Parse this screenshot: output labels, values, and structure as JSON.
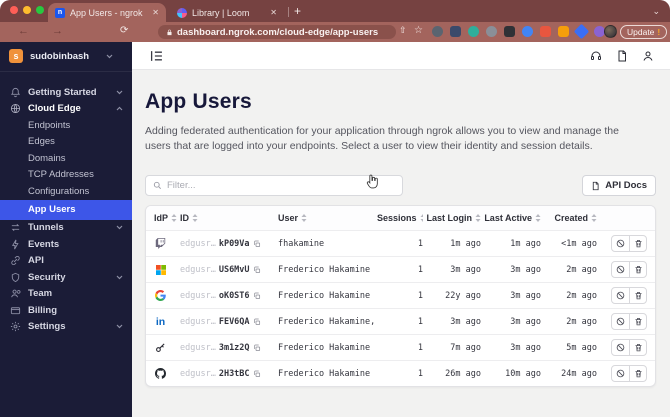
{
  "colors": {
    "chrome_dark": "#764241",
    "chrome_light": "#a3645d",
    "sidebar_bg": "#1b1c37",
    "accent_blue": "#3d56e8",
    "logo_orange": "#f0923b",
    "ms_red": "#f25022",
    "ms_green": "#7fba00",
    "ms_blue": "#00a4ef",
    "ms_yellow": "#ffb900",
    "linkedin_blue": "#0a66c2"
  },
  "icons": {
    "close": "✕",
    "plus": "+",
    "chevron_down": "⌄",
    "back": "←",
    "forward": "→",
    "refresh": "⟳",
    "star": "☆",
    "share": "⇧",
    "excl": "!"
  },
  "browser": {
    "tabs": [
      {
        "title": "App Users - ngrok"
      },
      {
        "title": "Library | Loom"
      }
    ],
    "url": "dashboard.ngrok.com/cloud-edge/app-users",
    "update_label": "Update"
  },
  "sidebar": {
    "account": {
      "name": "sudobinbash",
      "avatar_letter": "s"
    },
    "items": [
      {
        "label": "Getting Started"
      },
      {
        "label": "Cloud Edge"
      },
      {
        "label": "Endpoints"
      },
      {
        "label": "Edges"
      },
      {
        "label": "Domains"
      },
      {
        "label": "TCP Addresses"
      },
      {
        "label": "Configurations"
      },
      {
        "label": "App Users"
      },
      {
        "label": "Tunnels"
      },
      {
        "label": "Events"
      },
      {
        "label": "API"
      },
      {
        "label": "Security"
      },
      {
        "label": "Team"
      },
      {
        "label": "Billing"
      },
      {
        "label": "Settings"
      }
    ]
  },
  "main": {
    "title": "App Users",
    "description": "Adding federated authentication for your application through ngrok allows you to view and manage the users that are logged into your endpoints. Select a user to view their identity and session details.",
    "filter_placeholder": "Filter...",
    "api_docs_label": "API Docs"
  },
  "table": {
    "headers": [
      "IdP",
      "ID",
      "User",
      "Sessions",
      "Last Login",
      "Last Active",
      "Created"
    ],
    "rows": [
      {
        "idp": "Twitch",
        "id_prefix": "edgusr…",
        "id_suffix": "kP09Va",
        "user": "fhakamine",
        "sessions": "1",
        "last_login": "1m ago",
        "last_active": "1m ago",
        "created": "<1m ago"
      },
      {
        "idp": "Microsoft",
        "id_prefix": "edgusr…",
        "id_suffix": "US6MvU",
        "user": "Frederico Hakamine",
        "sessions": "1",
        "last_login": "3m ago",
        "last_active": "3m ago",
        "created": "2m ago"
      },
      {
        "idp": "Google",
        "id_prefix": "edgusr…",
        "id_suffix": "oK0ST6",
        "user": "Frederico Hakamine",
        "sessions": "1",
        "last_login": "22y ago",
        "last_active": "3m ago",
        "created": "2m ago"
      },
      {
        "idp": "LinkedIn",
        "id_prefix": "edgusr…",
        "id_suffix": "FEV6QA",
        "user": "Frederico Hakamine, CISSP CCSP",
        "sessions": "1",
        "last_login": "3m ago",
        "last_active": "3m ago",
        "created": "2m ago"
      },
      {
        "idp": "OIDC Key",
        "id_prefix": "edgusr…",
        "id_suffix": "3m1z2Q",
        "user": "Frederico Hakamine",
        "sessions": "1",
        "last_login": "7m ago",
        "last_active": "3m ago",
        "created": "5m ago"
      },
      {
        "idp": "GitHub",
        "id_prefix": "edgusr…",
        "id_suffix": "2H3tBC",
        "user": "Frederico Hakamine",
        "sessions": "1",
        "last_login": "26m ago",
        "last_active": "10m ago",
        "created": "24m ago"
      }
    ]
  }
}
